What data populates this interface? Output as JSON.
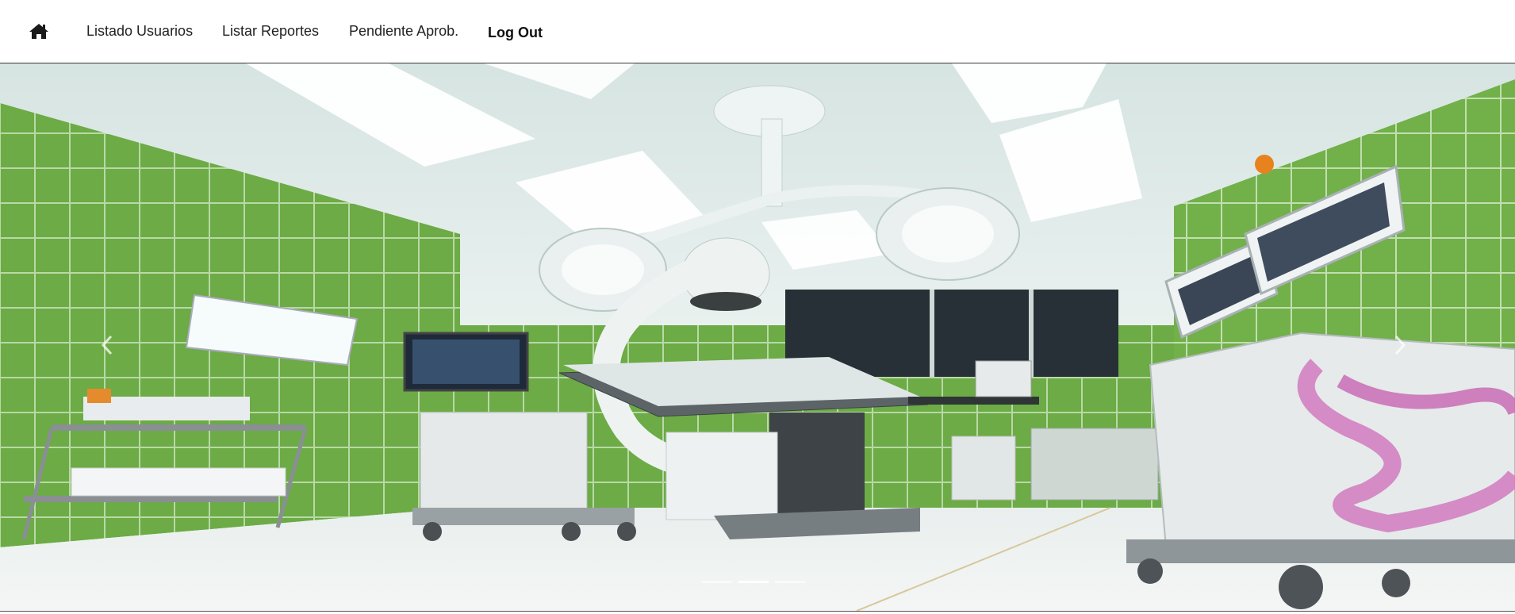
{
  "nav": {
    "home_icon": "home-icon",
    "links": [
      {
        "label": "Listado Usuarios"
      },
      {
        "label": "Listar Reportes"
      },
      {
        "label": "Pendiente Aprob."
      }
    ],
    "logout_label": "Log Out"
  },
  "carousel": {
    "slide_image": "operating-room-photo",
    "prev_icon": "chevron-left-icon",
    "next_icon": "chevron-right-icon",
    "indicator_count": 3,
    "active_indicator": 2
  },
  "colors": {
    "navbar_bg": "#ffffff",
    "wall_tiles": "#6aa84f",
    "ceiling": "#e4eeec"
  }
}
